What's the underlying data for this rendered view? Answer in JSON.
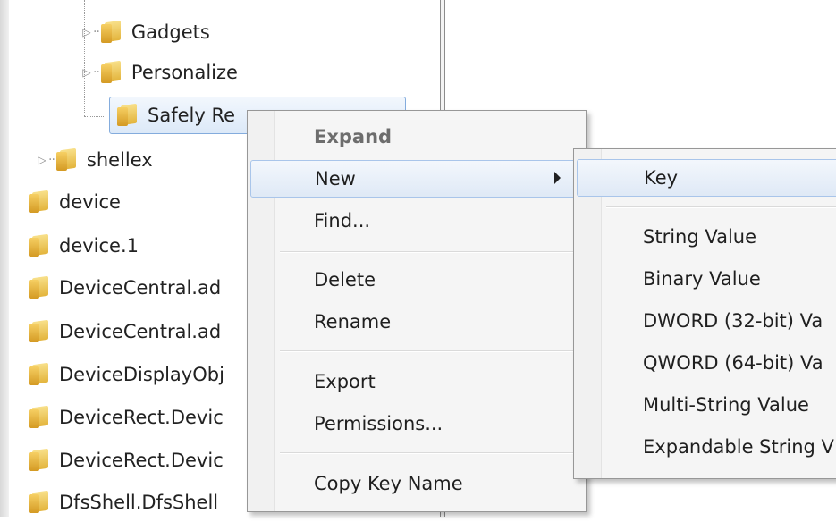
{
  "tree": {
    "items": [
      {
        "label": "Gadgets"
      },
      {
        "label": "Personalize"
      },
      {
        "label": "Safely Re"
      },
      {
        "label": "shellex"
      },
      {
        "label": "device"
      },
      {
        "label": "device.1"
      },
      {
        "label": "DeviceCentral.ad"
      },
      {
        "label": "DeviceCentral.ad"
      },
      {
        "label": "DeviceDisplayObj"
      },
      {
        "label": "DeviceRect.Devic"
      },
      {
        "label": "DeviceRect.Devic"
      },
      {
        "label": "DfsShell.DfsShell"
      }
    ]
  },
  "context_menu": {
    "items": [
      {
        "label": "Expand"
      },
      {
        "label": "New"
      },
      {
        "label": "Find..."
      },
      {
        "label": "Delete"
      },
      {
        "label": "Rename"
      },
      {
        "label": "Export"
      },
      {
        "label": "Permissions..."
      },
      {
        "label": "Copy Key Name"
      }
    ]
  },
  "submenu": {
    "items": [
      {
        "label": "Key"
      },
      {
        "label": "String Value"
      },
      {
        "label": "Binary Value"
      },
      {
        "label": "DWORD (32-bit) Va"
      },
      {
        "label": "QWORD (64-bit) Va"
      },
      {
        "label": "Multi-String Value"
      },
      {
        "label": "Expandable String V"
      }
    ]
  }
}
